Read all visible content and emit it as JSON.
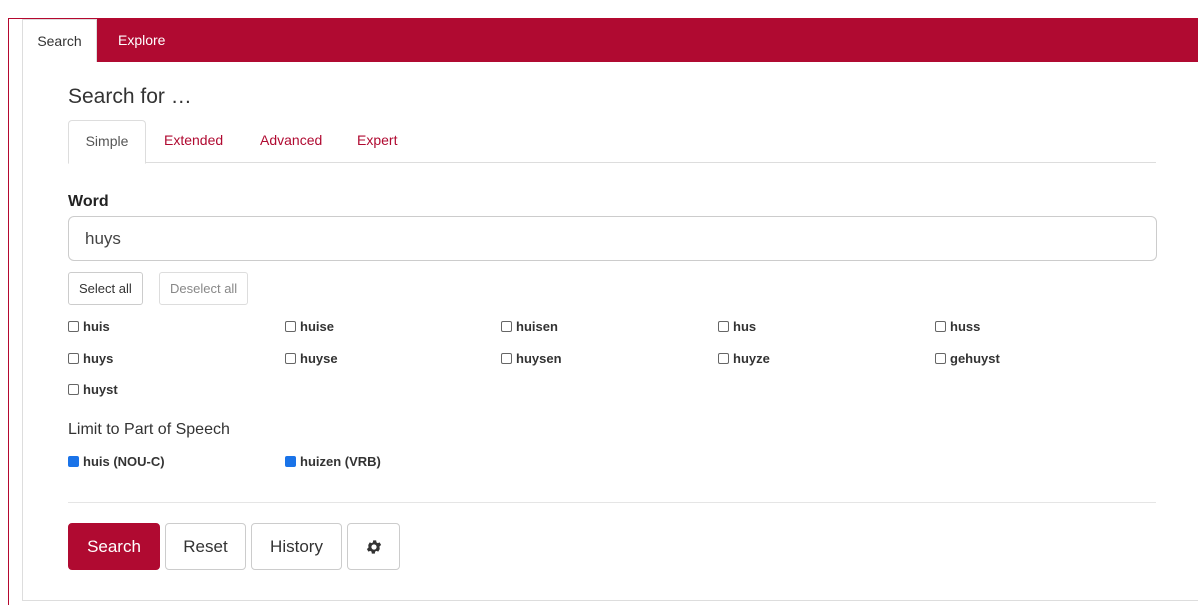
{
  "top_tabs": {
    "search": "Search",
    "explore": "Explore"
  },
  "heading": "Search for …",
  "sub_tabs": {
    "simple": "Simple",
    "extended": "Extended",
    "advanced": "Advanced",
    "expert": "Expert"
  },
  "word": {
    "label": "Word",
    "value": "huys",
    "select_all": "Select all",
    "deselect_all": "Deselect all",
    "variants": [
      {
        "label": "huis",
        "checked": false
      },
      {
        "label": "huise",
        "checked": false
      },
      {
        "label": "huisen",
        "checked": false
      },
      {
        "label": "hus",
        "checked": false
      },
      {
        "label": "huss",
        "checked": false
      },
      {
        "label": "huys",
        "checked": false
      },
      {
        "label": "huyse",
        "checked": false
      },
      {
        "label": "huysen",
        "checked": false
      },
      {
        "label": "huyze",
        "checked": false
      },
      {
        "label": "gehuyst",
        "checked": false
      },
      {
        "label": "huyst",
        "checked": false
      }
    ]
  },
  "pos": {
    "label": "Limit to Part of Speech",
    "items": [
      {
        "label": "huis (NOU-C)",
        "checked": true
      },
      {
        "label": "huizen (VRB)",
        "checked": true
      }
    ]
  },
  "actions": {
    "search": "Search",
    "reset": "Reset",
    "history": "History",
    "settings_icon": "gear-icon"
  },
  "colors": {
    "brand": "#b00a31",
    "check": "#1a73e8"
  }
}
